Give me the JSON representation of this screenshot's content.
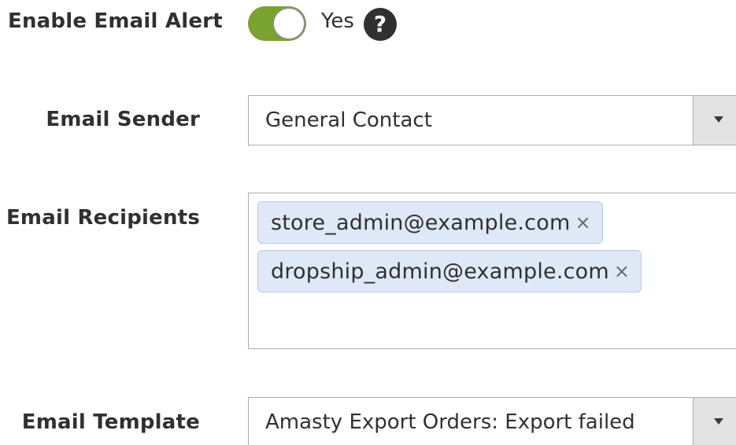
{
  "enable_email_alert": {
    "label": "Enable Email Alert",
    "value_text": "Yes",
    "enabled": true,
    "help_symbol": "?"
  },
  "email_sender": {
    "label": "Email Sender",
    "selected": "General Contact"
  },
  "email_recipients": {
    "label": "Email Recipients",
    "items": [
      "store_admin@example.com",
      "dropship_admin@example.com"
    ],
    "remove_symbol": "×"
  },
  "email_template": {
    "label": "Email Template",
    "selected": "Amasty Export Orders: Export failed"
  },
  "colors": {
    "toggle_on": "#79a22e",
    "chip_background": "#dfe8f7",
    "chip_border": "#b7cbee",
    "select_arrow_box": "#e3e3e3"
  },
  "icons": {
    "help": "question-circle-icon",
    "dropdown": "caret-down-icon",
    "remove": "close-icon"
  }
}
